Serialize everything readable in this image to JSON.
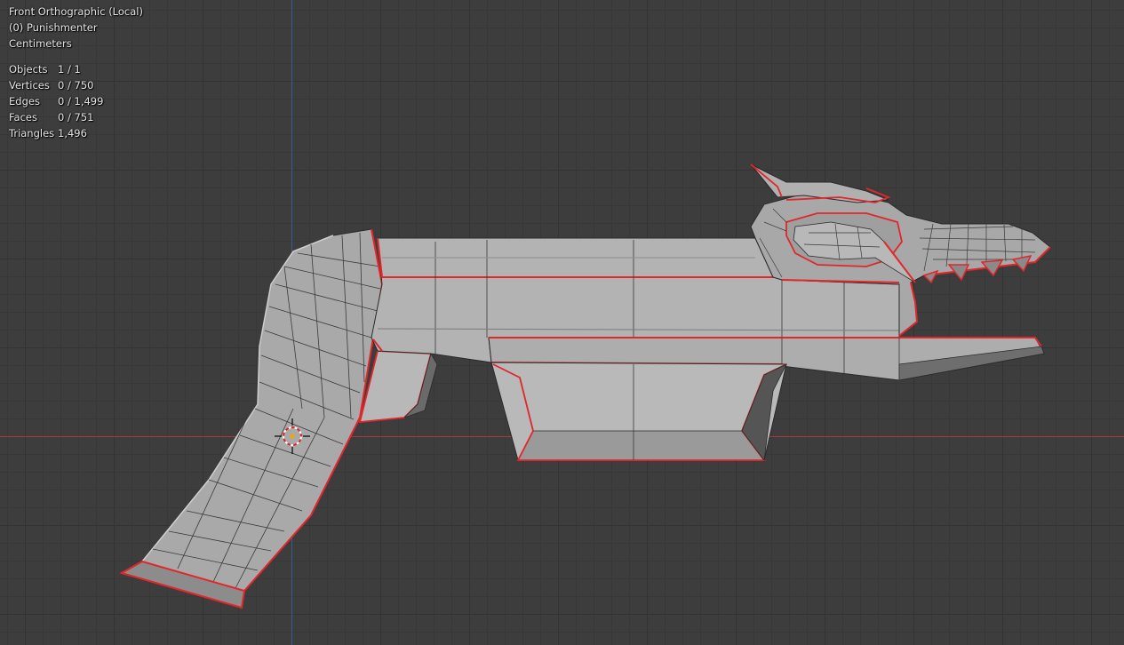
{
  "viewport": {
    "view_name": "Front Orthographic (Local)",
    "object_name": "(0) Punishmenter",
    "units": "Centimeters"
  },
  "statistics": [
    {
      "label": "Objects",
      "value": "1 / 1"
    },
    {
      "label": "Vertices",
      "value": "0 / 750"
    },
    {
      "label": "Edges",
      "value": "0 / 1,499"
    },
    {
      "label": "Faces",
      "value": "0 / 751"
    },
    {
      "label": "Triangles",
      "value": "1,496"
    }
  ],
  "colors": {
    "background": "#3d3d3d",
    "x_axis": "#a8393d",
    "z_axis": "#3d5a8f",
    "mesh_face": "#a9a9a9",
    "wire": "#2a2a2a",
    "seam": "#e0272b"
  },
  "icons": [
    "3d-cursor-icon"
  ]
}
